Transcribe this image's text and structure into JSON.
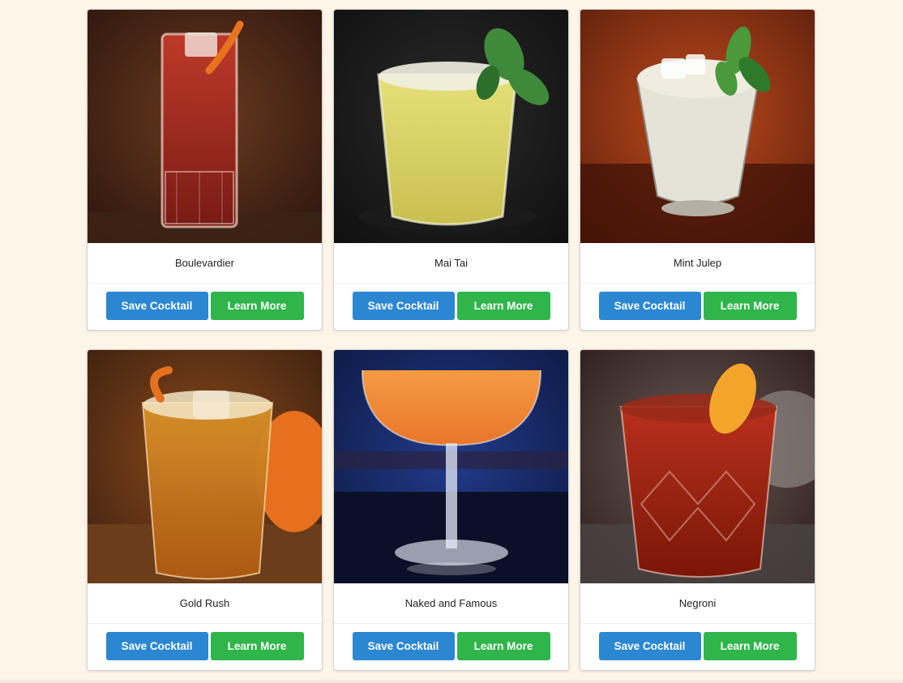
{
  "colors": {
    "page_background": "#fdf6e8",
    "save_button": "#2b87d1",
    "learn_button": "#2fb54a"
  },
  "cards": [
    {
      "name": "Boulevardier",
      "save_label": "Save Cocktail",
      "learn_label": "Learn More",
      "image_icon": "highball-glass-red-drink",
      "palette": {
        "bg1": "#2a140c",
        "bg2": "#6b3a20",
        "drink": "#c43a2a",
        "drink2": "#7a1a14",
        "glass": "#f3d6cc",
        "garnish": "#e8731f"
      }
    },
    {
      "name": "Mai Tai",
      "save_label": "Save Cocktail",
      "learn_label": "Learn More",
      "image_icon": "rocks-glass-yellow-drink-mint",
      "palette": {
        "bg1": "#0f0f0f",
        "bg2": "#2a2a2a",
        "drink": "#e6e07a",
        "drink2": "#c9c050",
        "glass": "#f4f2d8",
        "garnish": "#3f8a3a"
      }
    },
    {
      "name": "Mint Julep",
      "save_label": "Save Cocktail",
      "learn_label": "Learn More",
      "image_icon": "julep-cup-mint",
      "palette": {
        "bg1": "#5a1e0c",
        "bg2": "#c04a1c",
        "drink": "#d8d0b8",
        "drink2": "#9b9285",
        "glass": "#e5e2d8",
        "garnish": "#4a9a3c"
      }
    },
    {
      "name": "Gold Rush",
      "save_label": "Save Cocktail",
      "learn_label": "Learn More",
      "image_icon": "rocks-glass-amber-drink-orange",
      "palette": {
        "bg1": "#3a1e0e",
        "bg2": "#8a4a1c",
        "drink": "#d9922a",
        "drink2": "#b05a12",
        "glass": "#f1d29a",
        "garnish": "#e6701e"
      }
    },
    {
      "name": "Naked and Famous",
      "save_label": "Save Cocktail",
      "learn_label": "Learn More",
      "image_icon": "coupe-glass-orange-drink",
      "palette": {
        "bg1": "#0c1840",
        "bg2": "#223a8a",
        "drink": "#f59a42",
        "drink2": "#e8762a",
        "glass": "#e6ecf7",
        "garnish": "#f1b070"
      }
    },
    {
      "name": "Negroni",
      "save_label": "Save Cocktail",
      "learn_label": "Learn More",
      "image_icon": "crystal-rocks-glass-red-drink-orange-peel",
      "palette": {
        "bg1": "#2a1a18",
        "bg2": "#6a5a58",
        "drink": "#b8301c",
        "drink2": "#7a1608",
        "glass": "#e8c0b0",
        "garnish": "#f2a52a"
      }
    }
  ]
}
